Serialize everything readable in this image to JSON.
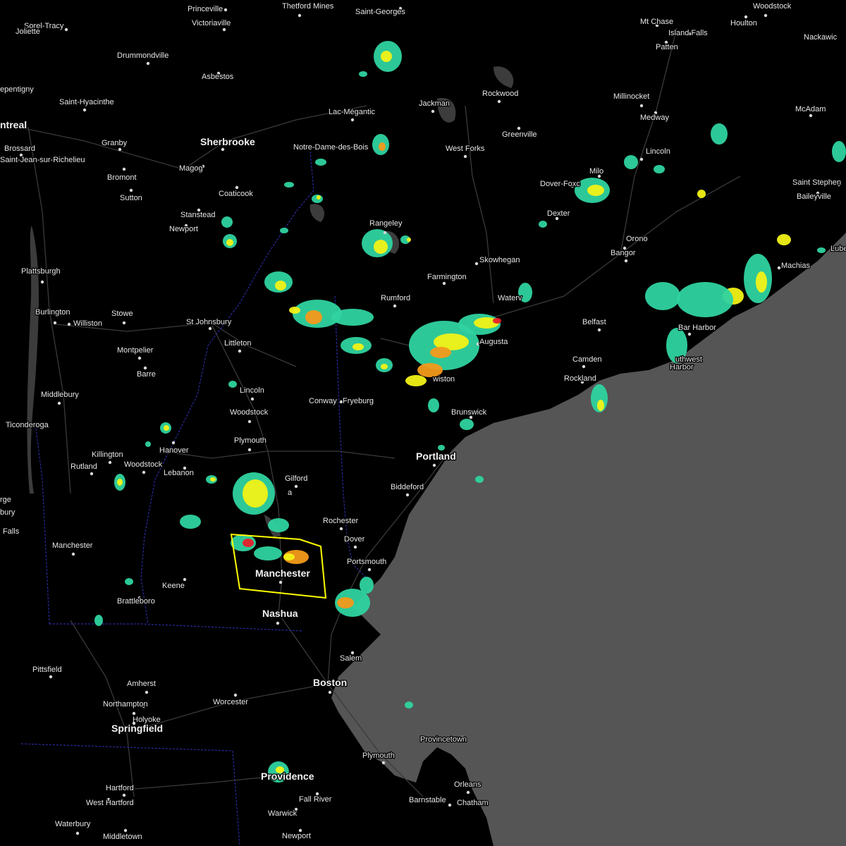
{
  "map": {
    "colors": {
      "land": "#000000",
      "ocean": "#555555",
      "roads": "#3a3a3a",
      "lakes": "#3c3c3c",
      "state_border": "#2a2aa0",
      "warning_polygon": "#ffff00",
      "radar_light": "#2fd3a0",
      "radar_green": "#1fa83a",
      "radar_yellow": "#f2f216",
      "radar_orange": "#f39a1a",
      "radar_red": "#e8202a"
    },
    "places": [
      {
        "id": "princeville",
        "name": "Princeville",
        "size": "small"
      },
      {
        "id": "thetford-mines",
        "name": "Thetford Mines",
        "size": "small"
      },
      {
        "id": "saint-georges",
        "name": "Saint-Georges",
        "size": "small"
      },
      {
        "id": "woodstock-nb",
        "name": "Woodstock",
        "size": "small"
      },
      {
        "id": "sorel-tracy",
        "name": "Sorel-Tracy",
        "size": "small"
      },
      {
        "id": "joliette",
        "name": "Joliette",
        "size": "small"
      },
      {
        "id": "victoriaville",
        "name": "Victoriaville",
        "size": "small"
      },
      {
        "id": "mt-chase",
        "name": "Mt Chase",
        "size": "small"
      },
      {
        "id": "island-falls",
        "name": "Island Falls",
        "size": "small"
      },
      {
        "id": "houlton",
        "name": "Houlton",
        "size": "small"
      },
      {
        "id": "nackawic",
        "name": "Nackawic",
        "size": "small"
      },
      {
        "id": "drummondville",
        "name": "Drummondville",
        "size": "small"
      },
      {
        "id": "patten",
        "name": "Patten",
        "size": "small"
      },
      {
        "id": "asbestos",
        "name": "Asbestos",
        "size": "small"
      },
      {
        "id": "repentigny",
        "name": "epentigny",
        "size": "small"
      },
      {
        "id": "rockwood",
        "name": "Rockwood",
        "size": "small"
      },
      {
        "id": "millinocket",
        "name": "Millinocket",
        "size": "small"
      },
      {
        "id": "saint-hyacinthe",
        "name": "Saint-Hyacinthe",
        "size": "small"
      },
      {
        "id": "jackman",
        "name": "Jackman",
        "size": "small"
      },
      {
        "id": "mcadam",
        "name": "McAdam",
        "size": "small"
      },
      {
        "id": "lac-megantic",
        "name": "Lac-Mégantic",
        "size": "small"
      },
      {
        "id": "medway",
        "name": "Medway",
        "size": "small"
      },
      {
        "id": "montreal",
        "name": "ntreal",
        "size": "big"
      },
      {
        "id": "greenville",
        "name": "Greenville",
        "size": "small"
      },
      {
        "id": "granby",
        "name": "Granby",
        "size": "small"
      },
      {
        "id": "sherbrooke",
        "name": "Sherbrooke",
        "size": "big"
      },
      {
        "id": "brossard",
        "name": "Brossard",
        "size": "small"
      },
      {
        "id": "notre-dame-des-bois",
        "name": "Notre-Dame-des-Bois",
        "size": "small"
      },
      {
        "id": "west-forks",
        "name": "West Forks",
        "size": "small"
      },
      {
        "id": "lincoln-me",
        "name": "Lincoln",
        "size": "small"
      },
      {
        "id": "saint-jean",
        "name": "Saint-Jean-sur-Richelieu",
        "size": "small"
      },
      {
        "id": "magog",
        "name": "Magog",
        "size": "small"
      },
      {
        "id": "milo",
        "name": "Milo",
        "size": "small"
      },
      {
        "id": "bromont",
        "name": "Bromont",
        "size": "small"
      },
      {
        "id": "saint-stephen",
        "name": "Saint Stephen",
        "size": "small"
      },
      {
        "id": "dover-foxcroft",
        "name": "Dover-Foxc",
        "size": "small"
      },
      {
        "id": "coaticook",
        "name": "Coaticook",
        "size": "small"
      },
      {
        "id": "baileyville",
        "name": "Baileyville",
        "size": "small"
      },
      {
        "id": "sutton",
        "name": "Sutton",
        "size": "small"
      },
      {
        "id": "dexter",
        "name": "Dexter",
        "size": "small"
      },
      {
        "id": "stanstead",
        "name": "Stanstead",
        "size": "small"
      },
      {
        "id": "rangeley",
        "name": "Rangeley",
        "size": "small"
      },
      {
        "id": "newport-vt",
        "name": "Newport",
        "size": "small"
      },
      {
        "id": "orono",
        "name": "Orono",
        "size": "small"
      },
      {
        "id": "lubec",
        "name": "Lube",
        "size": "small"
      },
      {
        "id": "bangor",
        "name": "Bangor",
        "size": "small"
      },
      {
        "id": "skowhegan",
        "name": "Skowhegan",
        "size": "small"
      },
      {
        "id": "plattsburgh",
        "name": "Plattsburgh",
        "size": "small"
      },
      {
        "id": "machias",
        "name": "Machias",
        "size": "small"
      },
      {
        "id": "farmington",
        "name": "Farmington",
        "size": "small"
      },
      {
        "id": "rumford",
        "name": "Rumford",
        "size": "small"
      },
      {
        "id": "waterville",
        "name": "Waterv",
        "size": "small"
      },
      {
        "id": "burlington",
        "name": "Burlington",
        "size": "small"
      },
      {
        "id": "stowe",
        "name": "Stowe",
        "size": "small"
      },
      {
        "id": "st-johnsbury",
        "name": "St Johnsbury",
        "size": "small"
      },
      {
        "id": "belfast",
        "name": "Belfast",
        "size": "small"
      },
      {
        "id": "williston",
        "name": "Williston",
        "size": "small"
      },
      {
        "id": "bar-harbor",
        "name": "Bar Harbor",
        "size": "small"
      },
      {
        "id": "augusta",
        "name": "Augusta",
        "size": "small"
      },
      {
        "id": "littleton",
        "name": "Littleton",
        "size": "small"
      },
      {
        "id": "montpelier",
        "name": "Montpelier",
        "size": "small"
      },
      {
        "id": "southwest-harbor-1",
        "name": "uthwest",
        "size": "small"
      },
      {
        "id": "camden",
        "name": "Camden",
        "size": "small"
      },
      {
        "id": "southwest-harbor-2",
        "name": "Harbor",
        "size": "small"
      },
      {
        "id": "barre",
        "name": "Barre",
        "size": "small"
      },
      {
        "id": "lewiston",
        "name": "wiston",
        "size": "small"
      },
      {
        "id": "rockland",
        "name": "Rockland",
        "size": "small"
      },
      {
        "id": "lincoln-nh",
        "name": "Lincoln",
        "size": "small"
      },
      {
        "id": "middlebury",
        "name": "Middlebury",
        "size": "small"
      },
      {
        "id": "conway",
        "name": "Conway",
        "size": "small"
      },
      {
        "id": "fryeburg",
        "name": "Fryeburg",
        "size": "small"
      },
      {
        "id": "woodstock-nh",
        "name": "Woodstock",
        "size": "small"
      },
      {
        "id": "brunswick",
        "name": "Brunswick",
        "size": "small"
      },
      {
        "id": "ticonderoga",
        "name": "Ticonderoga",
        "size": "small"
      },
      {
        "id": "plymouth-nh",
        "name": "Plymouth",
        "size": "small"
      },
      {
        "id": "hanover",
        "name": "Hanover",
        "size": "small"
      },
      {
        "id": "killington",
        "name": "Killington",
        "size": "small"
      },
      {
        "id": "portland",
        "name": "Portland",
        "size": "big"
      },
      {
        "id": "woodstock-vt",
        "name": "Woodstock",
        "size": "small"
      },
      {
        "id": "rutland",
        "name": "Rutland",
        "size": "small"
      },
      {
        "id": "lebanon",
        "name": "Lebanon",
        "size": "small"
      },
      {
        "id": "gilford",
        "name": "Gilford",
        "size": "small"
      },
      {
        "id": "biddeford",
        "name": "Biddeford",
        "size": "small"
      },
      {
        "id": "laconia",
        "name": "a",
        "size": "small"
      },
      {
        "id": "george",
        "name": "rge",
        "size": "small"
      },
      {
        "id": "sudbury",
        "name": "bury",
        "size": "small"
      },
      {
        "id": "rochester",
        "name": "Rochester",
        "size": "small"
      },
      {
        "id": "falls",
        "name": "Falls",
        "size": "small"
      },
      {
        "id": "manchester-vt",
        "name": "Manchester",
        "size": "small"
      },
      {
        "id": "dover-nh",
        "name": "Dover",
        "size": "small"
      },
      {
        "id": "portsmouth",
        "name": "Portsmouth",
        "size": "small"
      },
      {
        "id": "manchester-nh",
        "name": "Manchester",
        "size": "big"
      },
      {
        "id": "keene",
        "name": "Keene",
        "size": "small"
      },
      {
        "id": "brattleboro",
        "name": "Brattleboro",
        "size": "small"
      },
      {
        "id": "nashua",
        "name": "Nashua",
        "size": "big"
      },
      {
        "id": "salem",
        "name": "Salem",
        "size": "small"
      },
      {
        "id": "pittsfield",
        "name": "Pittsfield",
        "size": "small"
      },
      {
        "id": "boston",
        "name": "Boston",
        "size": "big"
      },
      {
        "id": "amherst",
        "name": "Amherst",
        "size": "small"
      },
      {
        "id": "worcester",
        "name": "Worcester",
        "size": "small"
      },
      {
        "id": "northampton",
        "name": "Northampton",
        "size": "small"
      },
      {
        "id": "holyoke",
        "name": "Holyoke",
        "size": "small"
      },
      {
        "id": "springfield",
        "name": "Springfield",
        "size": "big"
      },
      {
        "id": "provincetown",
        "name": "Provincetown",
        "size": "small"
      },
      {
        "id": "plymouth-ma",
        "name": "Plymouth",
        "size": "small"
      },
      {
        "id": "providence",
        "name": "Providence",
        "size": "big"
      },
      {
        "id": "orleans",
        "name": "Orleans",
        "size": "small"
      },
      {
        "id": "hartford",
        "name": "Hartford",
        "size": "small"
      },
      {
        "id": "fall-river",
        "name": "Fall River",
        "size": "small"
      },
      {
        "id": "barnstable",
        "name": "Barnstable",
        "size": "small"
      },
      {
        "id": "chatham",
        "name": "Chatham",
        "size": "small"
      },
      {
        "id": "west-hartford",
        "name": "West Hartford",
        "size": "small"
      },
      {
        "id": "warwick",
        "name": "Warwick",
        "size": "small"
      },
      {
        "id": "waterbury",
        "name": "Waterbury",
        "size": "small"
      },
      {
        "id": "newport-ri",
        "name": "Newport",
        "size": "small"
      },
      {
        "id": "middletown",
        "name": "Middletown",
        "size": "small"
      }
    ]
  }
}
